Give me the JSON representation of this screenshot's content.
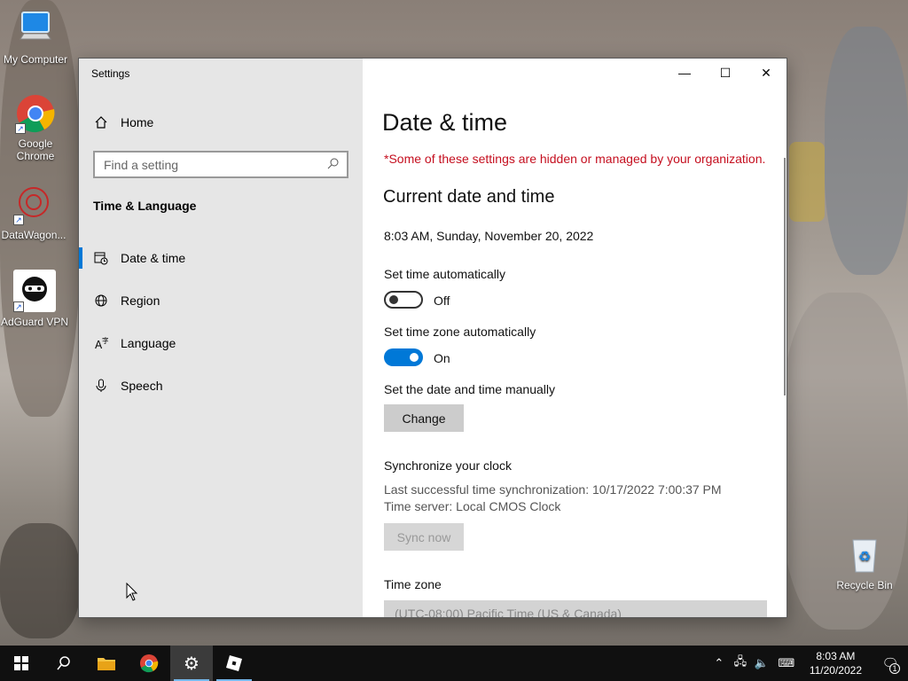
{
  "desktop": {
    "icons": [
      {
        "label": "My Computer"
      },
      {
        "label": "Google Chrome"
      },
      {
        "label": "DataWagon..."
      },
      {
        "label": "AdGuard VPN"
      },
      {
        "label": "Recycle Bin"
      }
    ]
  },
  "window": {
    "title": "Settings",
    "controls": {
      "minimize": "—",
      "maximize": "☐",
      "close": "✕"
    }
  },
  "sidebar": {
    "home_label": "Home",
    "search_placeholder": "Find a setting",
    "section": "Time & Language",
    "items": [
      {
        "label": "Date & time",
        "icon": "calendar-clock-icon",
        "active": true
      },
      {
        "label": "Region",
        "icon": "globe-icon"
      },
      {
        "label": "Language",
        "icon": "language-icon"
      },
      {
        "label": "Speech",
        "icon": "microphone-icon"
      }
    ]
  },
  "main": {
    "title": "Date & time",
    "org_note": "*Some of these settings are hidden or managed by your organization.",
    "current_heading": "Current date and time",
    "current_value": "8:03 AM, Sunday, November 20, 2022",
    "auto_time": {
      "label": "Set time automatically",
      "state": "Off"
    },
    "auto_zone": {
      "label": "Set time zone automatically",
      "state": "On"
    },
    "manual": {
      "label": "Set the date and time manually",
      "button": "Change"
    },
    "sync": {
      "heading": "Synchronize your clock",
      "last": "Last successful time synchronization: 10/17/2022 7:00:37 PM",
      "server": "Time server: Local CMOS Clock",
      "button": "Sync now"
    },
    "timezone": {
      "label": "Time zone",
      "value": "(UTC-08:00) Pacific Time (US & Canada)"
    }
  },
  "taskbar": {
    "time": "8:03 AM",
    "date": "11/20/2022",
    "notification_count": "1"
  },
  "colors": {
    "accent": "#0078d7",
    "warning": "#c50f1f"
  }
}
